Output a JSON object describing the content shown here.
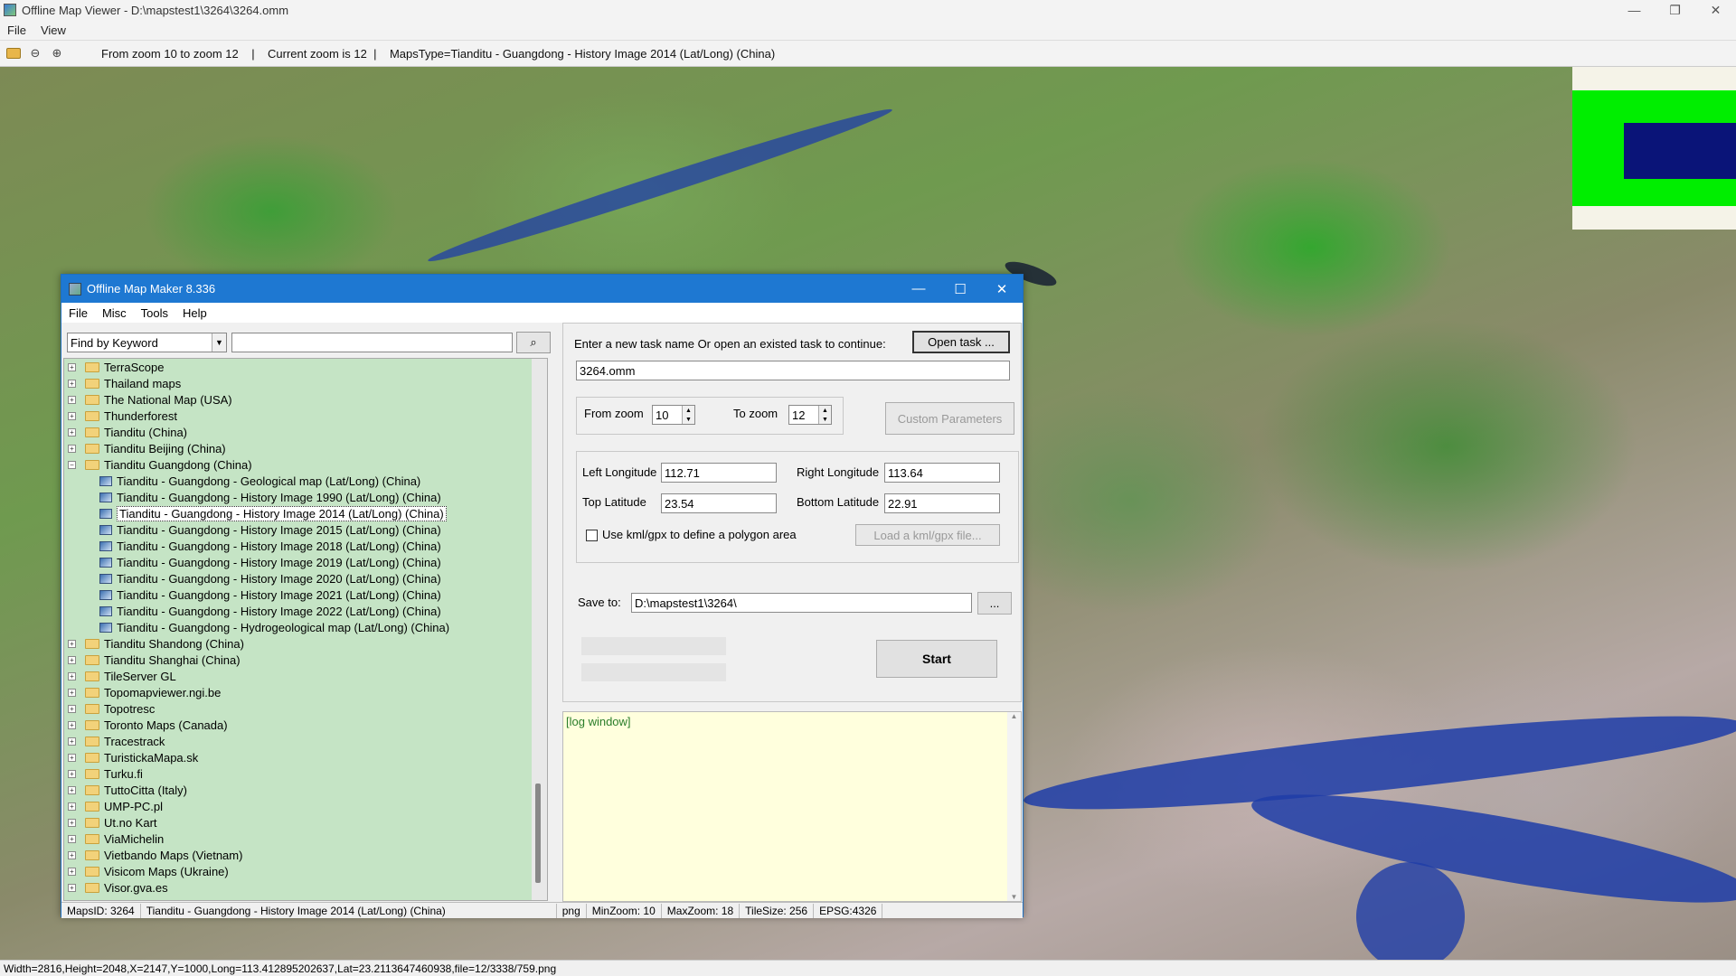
{
  "viewer": {
    "title": "Offline Map Viewer - D:\\mapstest1\\3264\\3264.omm",
    "controls": {
      "minimize": "—",
      "maximize": "❐",
      "close": "✕"
    },
    "menu": [
      "File",
      "View"
    ],
    "toolbar": {
      "zoom_range": "From zoom 10 to zoom 12",
      "current_zoom": "Current zoom is 12",
      "maps_type": "MapsType=Tianditu - Guangdong - History Image 2014 (Lat/Long) (China)",
      "separator": "|"
    },
    "status": "Width=2816,Height=2048,X=2147,Y=1000,Long=113.412895202637,Lat=23.2113647460938,file=12/3338/759.png",
    "minimap_colors": {
      "background": "#f5f3e8",
      "frame": "#00ee00",
      "viewport": "#0a1478"
    }
  },
  "omm": {
    "title": "Offline Map Maker 8.336",
    "controls": {
      "minimize": "—",
      "maximize": "☐",
      "close": "✕"
    },
    "menu": [
      "File",
      "Misc",
      "Tools",
      "Help"
    ],
    "find": {
      "mode": "Find by Keyword",
      "value": ""
    },
    "tree": [
      {
        "label": "TerraScope",
        "type": "folder"
      },
      {
        "label": "Thailand maps",
        "type": "folder"
      },
      {
        "label": "The National Map (USA)",
        "type": "folder"
      },
      {
        "label": "Thunderforest",
        "type": "folder"
      },
      {
        "label": "Tianditu (China)",
        "type": "folder"
      },
      {
        "label": "Tianditu Beijing (China)",
        "type": "folder"
      },
      {
        "label": "Tianditu Guangdong (China)",
        "type": "folder-open"
      },
      {
        "label": "Tianditu - Guangdong - Geological map (Lat/Long) (China)",
        "type": "map"
      },
      {
        "label": "Tianditu - Guangdong - History Image 1990 (Lat/Long) (China)",
        "type": "map"
      },
      {
        "label": "Tianditu - Guangdong - History Image 2014 (Lat/Long) (China)",
        "type": "map",
        "selected": true
      },
      {
        "label": "Tianditu - Guangdong - History Image 2015 (Lat/Long) (China)",
        "type": "map"
      },
      {
        "label": "Tianditu - Guangdong - History Image 2018 (Lat/Long) (China)",
        "type": "map"
      },
      {
        "label": "Tianditu - Guangdong - History Image 2019 (Lat/Long) (China)",
        "type": "map"
      },
      {
        "label": "Tianditu - Guangdong - History Image 2020 (Lat/Long) (China)",
        "type": "map"
      },
      {
        "label": "Tianditu - Guangdong - History Image 2021 (Lat/Long) (China)",
        "type": "map"
      },
      {
        "label": "Tianditu - Guangdong - History Image 2022 (Lat/Long) (China)",
        "type": "map"
      },
      {
        "label": "Tianditu - Guangdong - Hydrogeological map (Lat/Long) (China)",
        "type": "map"
      },
      {
        "label": "Tianditu Shandong (China)",
        "type": "folder"
      },
      {
        "label": "Tianditu Shanghai (China)",
        "type": "folder"
      },
      {
        "label": "TileServer GL",
        "type": "folder"
      },
      {
        "label": "Topomapviewer.ngi.be",
        "type": "folder"
      },
      {
        "label": "Topotresc",
        "type": "folder"
      },
      {
        "label": "Toronto Maps (Canada)",
        "type": "folder"
      },
      {
        "label": "Tracestrack",
        "type": "folder"
      },
      {
        "label": "TuristickaMapa.sk",
        "type": "folder"
      },
      {
        "label": "Turku.fi",
        "type": "folder"
      },
      {
        "label": "TuttoCitta (Italy)",
        "type": "folder"
      },
      {
        "label": "UMP-PC.pl",
        "type": "folder"
      },
      {
        "label": "Ut.no Kart",
        "type": "folder"
      },
      {
        "label": "ViaMichelin",
        "type": "folder"
      },
      {
        "label": "Vietbando Maps (Vietnam)",
        "type": "folder"
      },
      {
        "label": "Visicom Maps (Ukraine)",
        "type": "folder"
      },
      {
        "label": "Visor.gva.es",
        "type": "folder"
      }
    ],
    "task": {
      "prompt": "Enter a new task name Or open an existed task to continue:",
      "open_button": "Open task ...",
      "task_name": "3264.omm"
    },
    "zoom": {
      "from_label": "From zoom",
      "from_value": "10",
      "to_label": "To zoom",
      "to_value": "12",
      "custom_button": "Custom Parameters"
    },
    "bounds": {
      "left_lon_label": "Left Longitude",
      "left_lon": "112.71",
      "right_lon_label": "Right Longitude",
      "right_lon": "113.64",
      "top_lat_label": "Top Latitude",
      "top_lat": "23.54",
      "bottom_lat_label": "Bottom Latitude",
      "bottom_lat": "22.91",
      "kml_label": "Use kml/gpx to define a polygon area",
      "kml_button": "Load a kml/gpx file..."
    },
    "save": {
      "label": "Save to:",
      "path": "D:\\mapstest1\\3264\\",
      "browse": "..."
    },
    "start_button": "Start",
    "log_text": "[log window]",
    "status": {
      "maps_id": "MapsID: 3264",
      "maps_name": "Tianditu - Guangdong - History Image 2014 (Lat/Long) (China)",
      "format": "png",
      "min_zoom": "MinZoom: 10",
      "max_zoom": "MaxZoom: 18",
      "tile_size": "TileSize: 256",
      "epsg": "EPSG:4326"
    }
  }
}
